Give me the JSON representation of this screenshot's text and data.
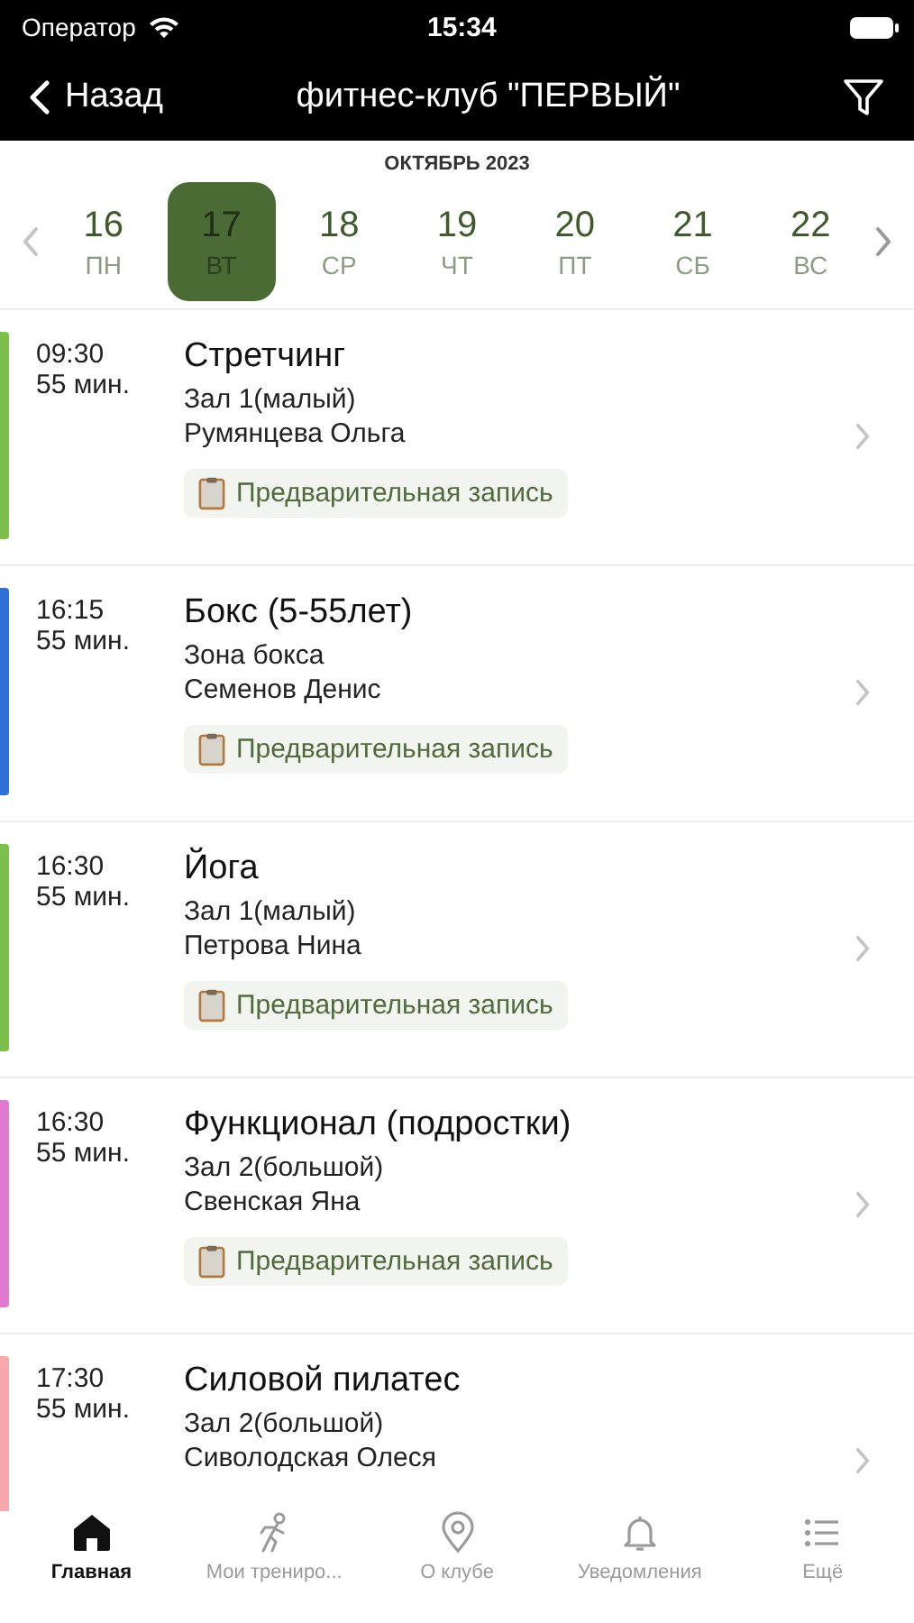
{
  "status_bar": {
    "carrier": "Оператор",
    "time": "15:34"
  },
  "nav": {
    "back": "Назад",
    "title": "фитнес-клуб \"ПЕРВЫЙ\""
  },
  "calendar": {
    "month": "ОКТЯБРЬ 2023",
    "days": [
      {
        "date": "16",
        "weekday": "ПН",
        "selected": false
      },
      {
        "date": "17",
        "weekday": "ВТ",
        "selected": true
      },
      {
        "date": "18",
        "weekday": "СР",
        "selected": false
      },
      {
        "date": "19",
        "weekday": "ЧТ",
        "selected": false
      },
      {
        "date": "20",
        "weekday": "ПТ",
        "selected": false
      },
      {
        "date": "21",
        "weekday": "СБ",
        "selected": false
      },
      {
        "date": "22",
        "weekday": "ВС",
        "selected": false
      }
    ]
  },
  "classes": [
    {
      "time": "09:30",
      "duration": "55 мин.",
      "title": "Стретчинг",
      "room": "Зал 1(малый)",
      "trainer": "Румянцева Ольга",
      "badge": "Предварительная запись",
      "color": "#7cc04b"
    },
    {
      "time": "16:15",
      "duration": "55 мин.",
      "title": "Бокс (5-55лет)",
      "room": "Зона бокса",
      "trainer": "Семенов Денис",
      "badge": "Предварительная запись",
      "color": "#2f6fd6"
    },
    {
      "time": "16:30",
      "duration": "55 мин.",
      "title": "Йога",
      "room": "Зал 1(малый)",
      "trainer": "Петрова Нина",
      "badge": "Предварительная запись",
      "color": "#7cc04b"
    },
    {
      "time": "16:30",
      "duration": "55 мин.",
      "title": "Функционал (подростки)",
      "room": "Зал 2(большой)",
      "trainer": "Свенская Яна",
      "badge": "Предварительная запись",
      "color": "#e07ad0"
    },
    {
      "time": "17:30",
      "duration": "55 мин.",
      "title": "Силовой пилатес",
      "room": "Зал 2(большой)",
      "trainer": "Сиволодская Олеся",
      "color": "#f7a8ac"
    }
  ],
  "tab_bar": [
    {
      "label": "Главная",
      "kind": "home",
      "selected": true
    },
    {
      "label": "Мои трениро...",
      "kind": "workouts",
      "selected": false
    },
    {
      "label": "О клубе",
      "kind": "club",
      "selected": false
    },
    {
      "label": "Уведомления",
      "kind": "notifications",
      "selected": false
    },
    {
      "label": "Ещё",
      "kind": "more",
      "selected": false
    }
  ]
}
